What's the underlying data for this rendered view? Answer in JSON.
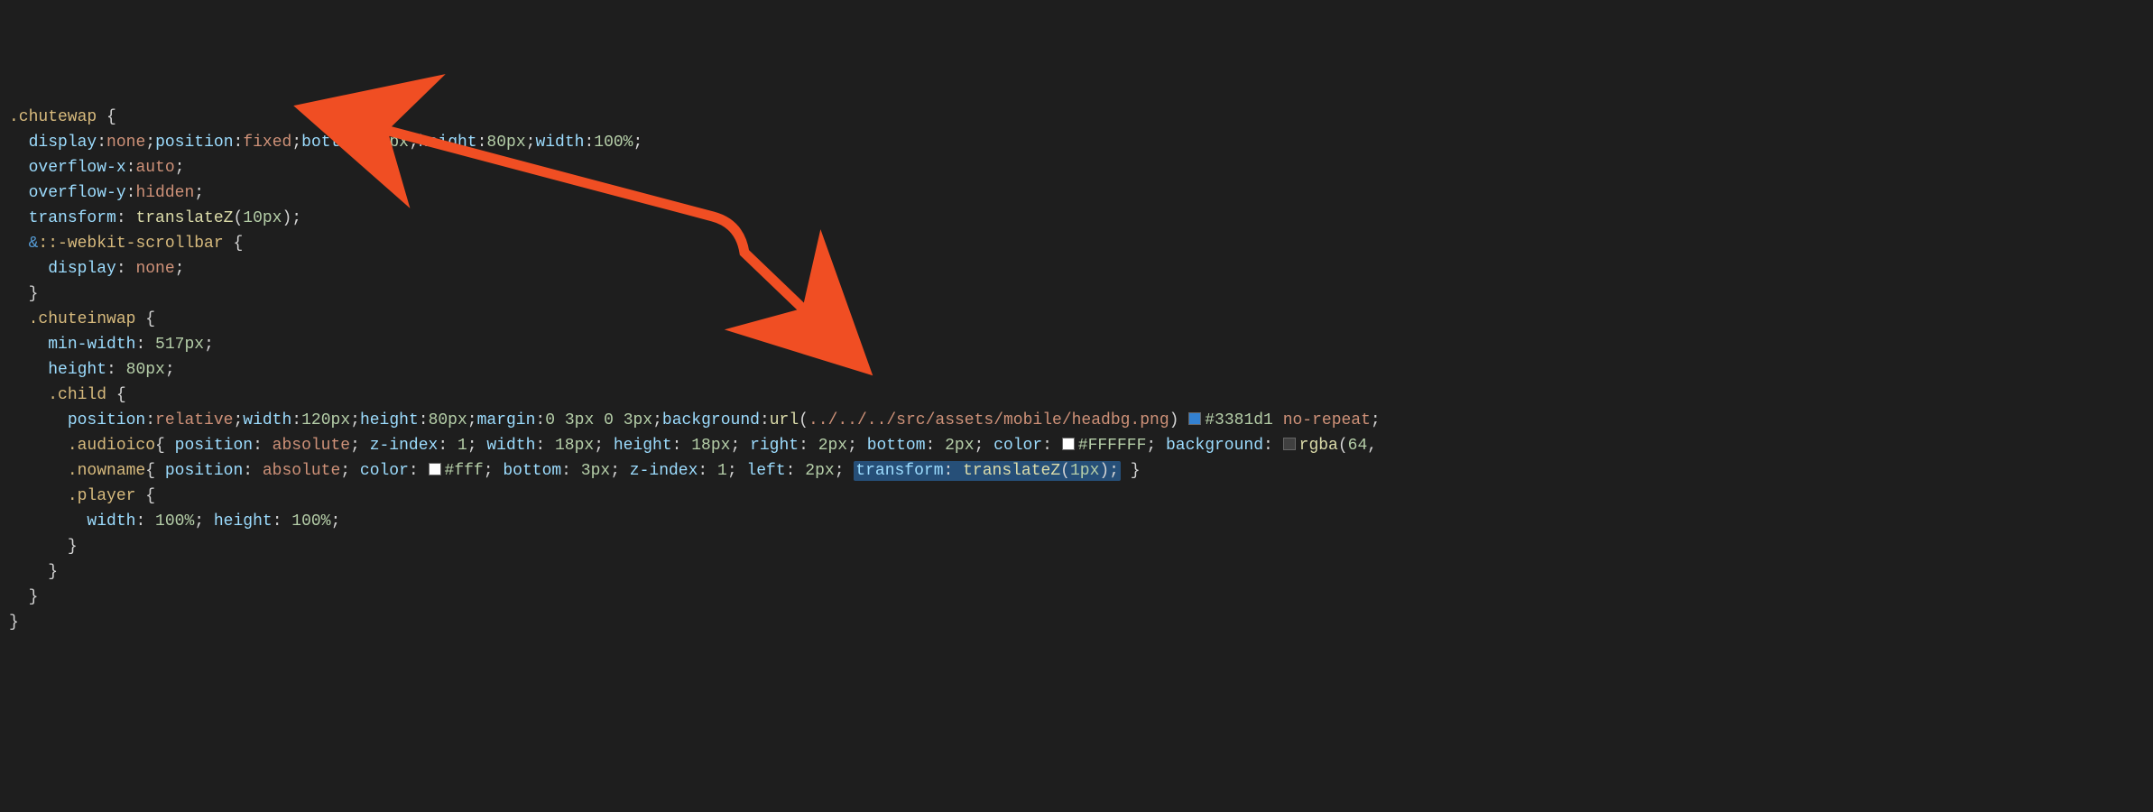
{
  "code": {
    "lines": [
      {
        "indent": 0,
        "parts": [
          {
            "t": "selector",
            "v": ".chutewap"
          },
          {
            "t": "punct",
            "v": " {"
          }
        ]
      },
      {
        "indent": 1,
        "parts": [
          {
            "t": "prop",
            "v": "display"
          },
          {
            "t": "punct",
            "v": ":"
          },
          {
            "t": "value-kw",
            "v": "none"
          },
          {
            "t": "punct",
            "v": ";"
          },
          {
            "t": "prop",
            "v": "position"
          },
          {
            "t": "punct",
            "v": ":"
          },
          {
            "t": "value-kw",
            "v": "fixed"
          },
          {
            "t": "punct",
            "v": ";"
          },
          {
            "t": "prop",
            "v": "bottom"
          },
          {
            "t": "punct",
            "v": ":"
          },
          {
            "t": "value-num",
            "v": "88px"
          },
          {
            "t": "punct",
            "v": ";"
          },
          {
            "t": "prop",
            "v": "height"
          },
          {
            "t": "punct",
            "v": ":"
          },
          {
            "t": "value-num",
            "v": "80px"
          },
          {
            "t": "punct",
            "v": ";"
          },
          {
            "t": "prop",
            "v": "width"
          },
          {
            "t": "punct",
            "v": ":"
          },
          {
            "t": "value-num",
            "v": "100%"
          },
          {
            "t": "punct",
            "v": ";"
          }
        ]
      },
      {
        "indent": 1,
        "parts": [
          {
            "t": "prop",
            "v": "overflow-x"
          },
          {
            "t": "punct",
            "v": ":"
          },
          {
            "t": "value-kw",
            "v": "auto"
          },
          {
            "t": "punct",
            "v": ";"
          }
        ]
      },
      {
        "indent": 1,
        "parts": [
          {
            "t": "prop",
            "v": "overflow-y"
          },
          {
            "t": "punct",
            "v": ":"
          },
          {
            "t": "value-kw",
            "v": "hidden"
          },
          {
            "t": "punct",
            "v": ";"
          }
        ]
      },
      {
        "indent": 1,
        "parts": [
          {
            "t": "prop",
            "v": "transform"
          },
          {
            "t": "punct",
            "v": ": "
          },
          {
            "t": "value-fn",
            "v": "translateZ"
          },
          {
            "t": "punct",
            "v": "("
          },
          {
            "t": "value-num",
            "v": "10px"
          },
          {
            "t": "punct",
            "v": ");"
          }
        ]
      },
      {
        "indent": 1,
        "parts": [
          {
            "t": "amp",
            "v": "&"
          },
          {
            "t": "selector",
            "v": "::-webkit-scrollbar"
          },
          {
            "t": "punct",
            "v": " {"
          }
        ]
      },
      {
        "indent": 2,
        "parts": [
          {
            "t": "prop",
            "v": "display"
          },
          {
            "t": "punct",
            "v": ": "
          },
          {
            "t": "value-kw",
            "v": "none"
          },
          {
            "t": "punct",
            "v": ";"
          }
        ]
      },
      {
        "indent": 1,
        "parts": [
          {
            "t": "punct",
            "v": "}"
          }
        ]
      },
      {
        "indent": 1,
        "parts": [
          {
            "t": "selector",
            "v": ".chuteinwap"
          },
          {
            "t": "punct",
            "v": " {"
          }
        ]
      },
      {
        "indent": 2,
        "parts": [
          {
            "t": "prop",
            "v": "min-width"
          },
          {
            "t": "punct",
            "v": ": "
          },
          {
            "t": "value-num",
            "v": "517px"
          },
          {
            "t": "punct",
            "v": ";"
          }
        ]
      },
      {
        "indent": 2,
        "parts": [
          {
            "t": "prop",
            "v": "height"
          },
          {
            "t": "punct",
            "v": ": "
          },
          {
            "t": "value-num",
            "v": "80px"
          },
          {
            "t": "punct",
            "v": ";"
          }
        ]
      },
      {
        "indent": 2,
        "parts": [
          {
            "t": "selector",
            "v": ".child"
          },
          {
            "t": "punct",
            "v": " {"
          }
        ]
      },
      {
        "indent": 3,
        "parts": [
          {
            "t": "prop",
            "v": "position"
          },
          {
            "t": "punct",
            "v": ":"
          },
          {
            "t": "value-kw",
            "v": "relative"
          },
          {
            "t": "punct",
            "v": ";"
          },
          {
            "t": "prop",
            "v": "width"
          },
          {
            "t": "punct",
            "v": ":"
          },
          {
            "t": "value-num",
            "v": "120px"
          },
          {
            "t": "punct",
            "v": ";"
          },
          {
            "t": "prop",
            "v": "height"
          },
          {
            "t": "punct",
            "v": ":"
          },
          {
            "t": "value-num",
            "v": "80px"
          },
          {
            "t": "punct",
            "v": ";"
          },
          {
            "t": "prop",
            "v": "margin"
          },
          {
            "t": "punct",
            "v": ":"
          },
          {
            "t": "value-num",
            "v": "0"
          },
          {
            "t": "punct",
            "v": " "
          },
          {
            "t": "value-num",
            "v": "3px"
          },
          {
            "t": "punct",
            "v": " "
          },
          {
            "t": "value-num",
            "v": "0"
          },
          {
            "t": "punct",
            "v": " "
          },
          {
            "t": "value-num",
            "v": "3px"
          },
          {
            "t": "punct",
            "v": ";"
          },
          {
            "t": "prop",
            "v": "background"
          },
          {
            "t": "punct",
            "v": ":"
          },
          {
            "t": "value-fn",
            "v": "url"
          },
          {
            "t": "punct",
            "v": "("
          },
          {
            "t": "value-str",
            "v": "../../../src/assets/mobile/headbg.png"
          },
          {
            "t": "punct",
            "v": ") "
          },
          {
            "t": "swatch",
            "sw": "blue"
          },
          {
            "t": "value-num",
            "v": "#3381d1"
          },
          {
            "t": "punct",
            "v": " "
          },
          {
            "t": "value-kw",
            "v": "no-repeat"
          },
          {
            "t": "punct",
            "v": ";"
          }
        ]
      },
      {
        "indent": 3,
        "parts": [
          {
            "t": "selector",
            "v": ".audioico"
          },
          {
            "t": "punct",
            "v": "{ "
          },
          {
            "t": "prop",
            "v": "position"
          },
          {
            "t": "punct",
            "v": ": "
          },
          {
            "t": "value-kw",
            "v": "absolute"
          },
          {
            "t": "punct",
            "v": "; "
          },
          {
            "t": "prop",
            "v": "z-index"
          },
          {
            "t": "punct",
            "v": ": "
          },
          {
            "t": "value-num",
            "v": "1"
          },
          {
            "t": "punct",
            "v": "; "
          },
          {
            "t": "prop",
            "v": "width"
          },
          {
            "t": "punct",
            "v": ": "
          },
          {
            "t": "value-num",
            "v": "18px"
          },
          {
            "t": "punct",
            "v": "; "
          },
          {
            "t": "prop",
            "v": "height"
          },
          {
            "t": "punct",
            "v": ": "
          },
          {
            "t": "value-num",
            "v": "18px"
          },
          {
            "t": "punct",
            "v": "; "
          },
          {
            "t": "prop",
            "v": "right"
          },
          {
            "t": "punct",
            "v": ": "
          },
          {
            "t": "value-num",
            "v": "2px"
          },
          {
            "t": "punct",
            "v": "; "
          },
          {
            "t": "prop",
            "v": "bottom"
          },
          {
            "t": "punct",
            "v": ": "
          },
          {
            "t": "value-num",
            "v": "2px"
          },
          {
            "t": "punct",
            "v": "; "
          },
          {
            "t": "prop",
            "v": "color"
          },
          {
            "t": "punct",
            "v": ": "
          },
          {
            "t": "swatch",
            "sw": "white"
          },
          {
            "t": "value-num",
            "v": "#FFFFFF"
          },
          {
            "t": "punct",
            "v": "; "
          },
          {
            "t": "prop",
            "v": "background"
          },
          {
            "t": "punct",
            "v": ": "
          },
          {
            "t": "swatch",
            "sw": "rgba"
          },
          {
            "t": "value-fn",
            "v": "rgba"
          },
          {
            "t": "punct",
            "v": "("
          },
          {
            "t": "value-num",
            "v": "64"
          },
          {
            "t": "punct",
            "v": ","
          }
        ]
      },
      {
        "indent": 3,
        "parts": [
          {
            "t": "selector",
            "v": ".nowname"
          },
          {
            "t": "punct",
            "v": "{ "
          },
          {
            "t": "prop",
            "v": "position"
          },
          {
            "t": "punct",
            "v": ": "
          },
          {
            "t": "value-kw",
            "v": "absolute"
          },
          {
            "t": "punct",
            "v": "; "
          },
          {
            "t": "prop",
            "v": "color"
          },
          {
            "t": "punct",
            "v": ": "
          },
          {
            "t": "swatch",
            "sw": "white2"
          },
          {
            "t": "value-num",
            "v": "#fff"
          },
          {
            "t": "punct",
            "v": "; "
          },
          {
            "t": "prop",
            "v": "bottom"
          },
          {
            "t": "punct",
            "v": ": "
          },
          {
            "t": "value-num",
            "v": "3px"
          },
          {
            "t": "punct",
            "v": "; "
          },
          {
            "t": "prop",
            "v": "z-index"
          },
          {
            "t": "punct",
            "v": ": "
          },
          {
            "t": "value-num",
            "v": "1"
          },
          {
            "t": "punct",
            "v": "; "
          },
          {
            "t": "prop",
            "v": "left"
          },
          {
            "t": "punct",
            "v": ": "
          },
          {
            "t": "value-num",
            "v": "2px"
          },
          {
            "t": "punct",
            "v": "; "
          },
          {
            "t": "highlight",
            "hp": [
              {
                "t": "prop",
                "v": "transform"
              },
              {
                "t": "punct",
                "v": ": "
              },
              {
                "t": "value-fn",
                "v": "translateZ"
              },
              {
                "t": "punct",
                "v": "("
              },
              {
                "t": "value-num",
                "v": "1px"
              },
              {
                "t": "punct",
                "v": ");"
              }
            ]
          },
          {
            "t": "punct",
            "v": " }"
          }
        ]
      },
      {
        "indent": 3,
        "parts": [
          {
            "t": "selector",
            "v": ".player"
          },
          {
            "t": "punct",
            "v": " {"
          }
        ]
      },
      {
        "indent": 4,
        "parts": [
          {
            "t": "prop",
            "v": "width"
          },
          {
            "t": "punct",
            "v": ": "
          },
          {
            "t": "value-num",
            "v": "100%"
          },
          {
            "t": "punct",
            "v": "; "
          },
          {
            "t": "prop",
            "v": "height"
          },
          {
            "t": "punct",
            "v": ": "
          },
          {
            "t": "value-num",
            "v": "100%"
          },
          {
            "t": "punct",
            "v": ";"
          }
        ]
      },
      {
        "indent": 3,
        "parts": [
          {
            "t": "punct",
            "v": "}"
          }
        ]
      },
      {
        "indent": 2,
        "parts": [
          {
            "t": "punct",
            "v": "}"
          }
        ]
      },
      {
        "indent": 1,
        "parts": [
          {
            "t": "punct",
            "v": "}"
          }
        ]
      },
      {
        "indent": 0,
        "parts": [
          {
            "t": "punct",
            "v": "}"
          }
        ]
      }
    ]
  },
  "annotation": {
    "type": "arrow",
    "color": "#f04e23",
    "from_line": 15,
    "to_line": 5,
    "description": "double-headed arrow linking transform: translateZ(1px) to transform: translateZ(10px)"
  }
}
